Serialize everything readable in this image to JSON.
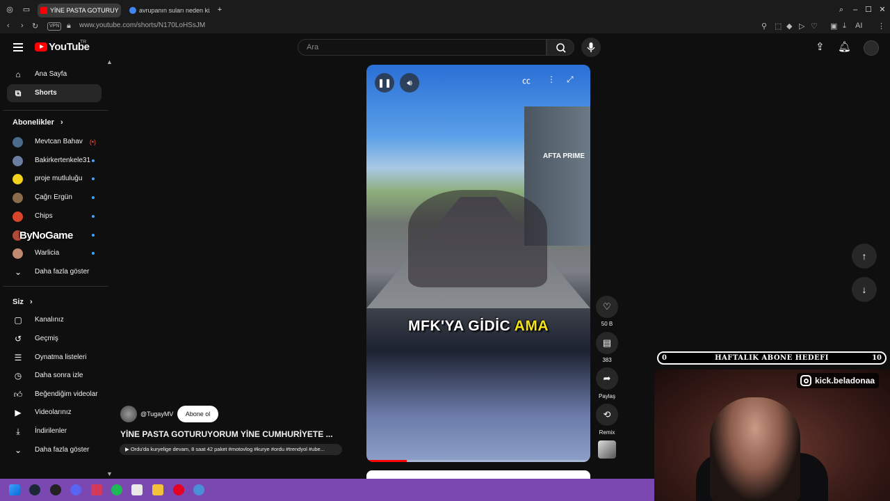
{
  "browser": {
    "tabs": [
      {
        "label": "YİNE PASTA GOTURUY",
        "active": true
      },
      {
        "label": "avrupanın suları neden kiz",
        "active": false
      }
    ],
    "new_tab_icon": "plus-icon",
    "url": "www.youtube.com/shorts/N170LoHSsJM",
    "vpn_label": "VPN",
    "ai_label": "AI"
  },
  "youtube": {
    "logo_text": "YouTube",
    "region": "TR",
    "search_placeholder": "Ara"
  },
  "sidebar": {
    "main": [
      {
        "label": "Ana Sayfa",
        "icon": "home-icon",
        "active": false
      },
      {
        "label": "Shorts",
        "icon": "shorts-icon",
        "active": true
      }
    ],
    "subscriptions_heading": "Abonelikler",
    "subscriptions": [
      {
        "label": "Mevtcan Bahav",
        "status": "live",
        "live_icon": "(•)"
      },
      {
        "label": "Bakirkertenkele31",
        "status": "dot"
      },
      {
        "label": "proje mutluluğu",
        "status": "dot"
      },
      {
        "label": "Çağrı Ergün",
        "status": "dot"
      },
      {
        "label": "Chips",
        "status": "dot"
      },
      {
        "label": "",
        "status": "dot"
      },
      {
        "label": "Warlicia",
        "status": "dot"
      }
    ],
    "show_more": "Daha fazla göster",
    "you_heading": "Siz",
    "you_items": [
      {
        "label": "Kanalınız",
        "icon": "channel-icon"
      },
      {
        "label": "Geçmiş",
        "icon": "history-icon"
      },
      {
        "label": "Oynatma listeleri",
        "icon": "playlist-icon"
      },
      {
        "label": "Daha sonra izle",
        "icon": "clock-icon"
      },
      {
        "label": "Beğendiğim videolar",
        "icon": "thumbs-up-icon"
      },
      {
        "label": "Videolarınız",
        "icon": "video-icon"
      },
      {
        "label": "İndirilenler",
        "icon": "download-icon"
      },
      {
        "label": "Daha fazla göster",
        "icon": "chevron-down-icon"
      }
    ],
    "overlay_watermark": "ByNoGame"
  },
  "short": {
    "caption_white": "MFK'YA GİDİC ",
    "caption_yellow": "AMA",
    "storefront_sign": "AFTA PRIME",
    "progress": 0.18,
    "channel": "@TugayMV",
    "subscribe": "Abone ol",
    "title": "YİNE PASTA GOTURUYORUM YİNE CUMHURİYETE ...",
    "description": "▶ Ordu'da kuryelige devam, 8 saat 42 paket #motovlog #kurye #ordu #trendyol #ube..."
  },
  "actions": {
    "like_count": "50 B",
    "comment_count": "383",
    "share_label": "Paylaş",
    "remix_label": "Remix"
  },
  "stream_overlay": {
    "goal_title": "HAFTALIK ABONE HEDEFI",
    "goal_min": "0",
    "goal_max": "10",
    "social_handle": "kick.beladonaa"
  },
  "colors": {
    "accent_red": "#ff0000",
    "taskbar_purple": "#7a48b0",
    "caption_yellow": "#f5e31a"
  }
}
